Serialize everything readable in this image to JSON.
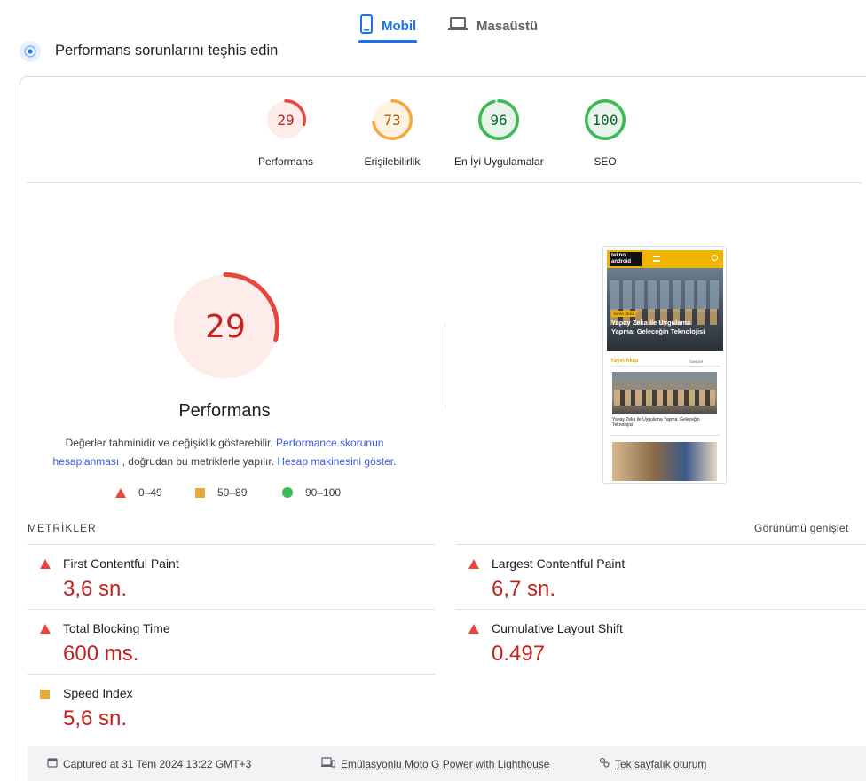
{
  "tabs": [
    {
      "label": "Mobil",
      "icon": "smartphone-icon",
      "active": true
    },
    {
      "label": "Masaüstü",
      "icon": "laptop-icon",
      "active": false
    }
  ],
  "diagnose_title": "Performans sorunlarını teşhis edin",
  "categories": [
    {
      "score": "29",
      "label": "Performans",
      "status": "fail",
      "color": "#e8453c",
      "fill": 0.29
    },
    {
      "score": "73",
      "label": "Erişilebilirlik",
      "status": "average",
      "color": "#f4a93c",
      "fill": 0.73
    },
    {
      "score": "96",
      "label": "En İyi Uygulamalar",
      "status": "pass",
      "color": "#3cba54",
      "fill": 0.96
    },
    {
      "score": "100",
      "label": "SEO",
      "status": "pass",
      "color": "#3cba54",
      "fill": 1.0
    }
  ],
  "performance": {
    "score": "29",
    "fill": 0.29,
    "title": "Performans",
    "desc_1": "Değerler tahminidir ve değişiklik gösterebilir.",
    "link_1": "Performance skorunun hesaplanması",
    "desc_2": ", doğrudan bu metriklerle yapılır.",
    "link_2": "Hesap makinesini göster",
    "desc_3": "."
  },
  "legend": [
    {
      "range": "0–49",
      "shape": "triangle"
    },
    {
      "range": "50–89",
      "shape": "square"
    },
    {
      "range": "90–100",
      "shape": "circle"
    }
  ],
  "screenshot": {
    "logo_top": "tekno",
    "logo_bottom": "android",
    "hero_badge": "YAPAY ZEKA",
    "hero_title": "Yapay Zeka ile Uygulama Yapma: Geleceğin Teknolojisi",
    "feed_title": "Yayın Akışı",
    "feed_filter": "TÜMLER",
    "card_title": "Yapay Zeka ile Uygulama Yapma: Geleceğin Teknolojisi"
  },
  "metrics": {
    "heading": "METRİKLER",
    "expand": "Görünümü genişlet",
    "items": [
      {
        "name": "First Contentful Paint",
        "value": "3,6 sn.",
        "status": "fail"
      },
      {
        "name": "Largest Contentful Paint",
        "value": "6,7 sn.",
        "status": "fail"
      },
      {
        "name": "Total Blocking Time",
        "value": "600 ms.",
        "status": "fail"
      },
      {
        "name": "Cumulative Layout Shift",
        "value": "0.497",
        "status": "fail"
      },
      {
        "name": "Speed Index",
        "value": "5,6 sn.",
        "status": "average"
      }
    ]
  },
  "footer": {
    "captured": "Captured at 31 Tem 2024 13:22 GMT+3",
    "device": "Emülasyonlu Moto G Power with Lighthouse",
    "session": "Tek sayfalık oturum"
  }
}
